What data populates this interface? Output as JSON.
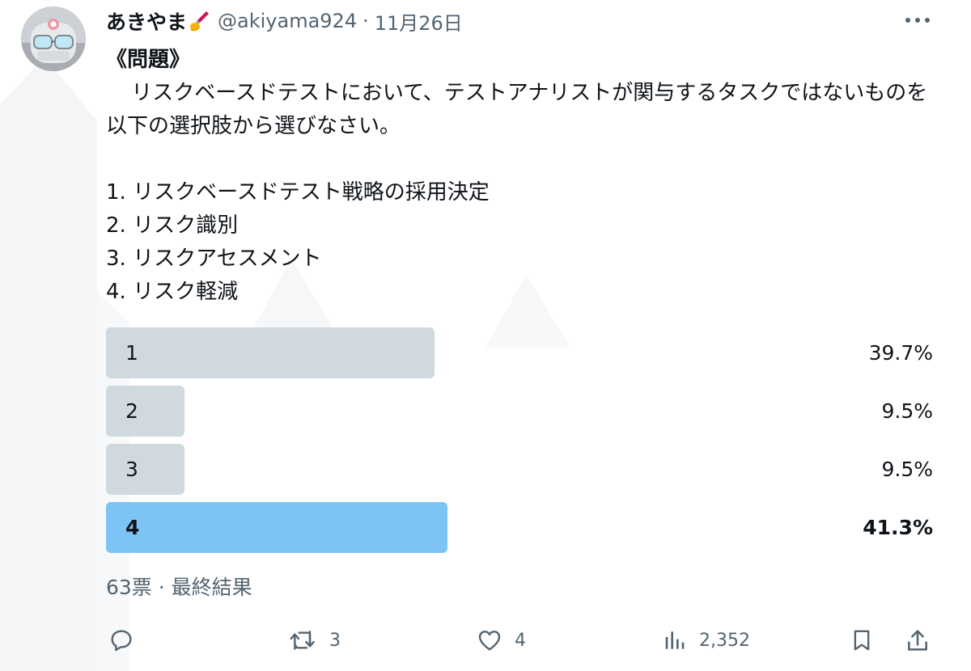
{
  "author": {
    "display_name": "あきやま",
    "handle": "@akiyama924",
    "separator": "·",
    "date": "11月26日",
    "name_emoji_icon": "paintbrush-icon"
  },
  "post": {
    "heading": "《問題》",
    "body": "リスクベースドテストにおいて、テストアナリストが関与するタスクではないものを以下の選択肢から選びなさい。",
    "choices": [
      "1. リスクベースドテスト戦略の採用決定",
      "2. リスク識別",
      "3. リスクアセスメント",
      "4. リスク軽減"
    ]
  },
  "poll": {
    "options": [
      {
        "label": "1",
        "percent_text": "39.7%",
        "percent": 39.7,
        "winner": false
      },
      {
        "label": "2",
        "percent_text": "9.5%",
        "percent": 9.5,
        "winner": false
      },
      {
        "label": "3",
        "percent_text": "9.5%",
        "percent": 9.5,
        "winner": false
      },
      {
        "label": "4",
        "percent_text": "41.3%",
        "percent": 41.3,
        "winner": true
      }
    ],
    "footer": "63票 · 最終結果"
  },
  "actions": {
    "reply_count": "",
    "repost_count": "3",
    "like_count": "4",
    "views_count": "2,352"
  },
  "colors": {
    "text": "#0f1419",
    "muted": "#536471",
    "poll_bar": "#cfd9de",
    "poll_bar_winner": "#7cc4f5",
    "icon": "#536471"
  }
}
